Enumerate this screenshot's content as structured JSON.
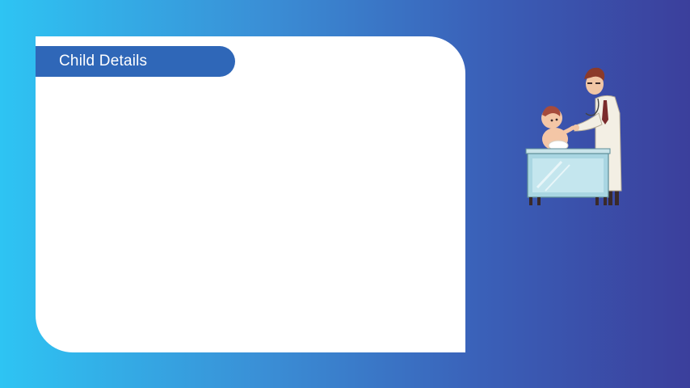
{
  "panel": {
    "title": "Child Details"
  },
  "illustration": {
    "icon": "doctor-examining-baby-icon"
  }
}
